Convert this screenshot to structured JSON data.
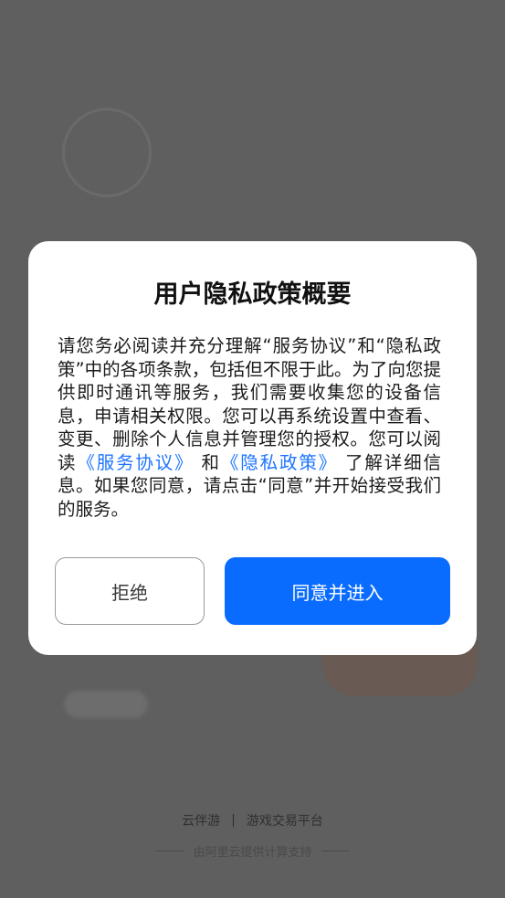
{
  "dialog": {
    "title": "用户隐私政策概要",
    "body_part1": "请您务必阅读并充分理解“服务协议”和“隐私政策”中的各项条款，包括但不限于此。为了向您提供即时通讯等服务，我们需要收集您的设备信息，申请相关权限。您可以再系统设置中查看、变更、删除个人信息并管理您的授权。您可以阅读",
    "link_service": "《服务协议》",
    "body_and": "和",
    "link_privacy": "《隐私政策》",
    "body_part2": " 了解详细信息。如果您同意，请点击“同意”并开始接受我们的服务。",
    "reject_label": "拒绝",
    "agree_label": "同意并进入"
  },
  "footer": {
    "brand": "云伴游",
    "separator": "|",
    "slogan": "游戏交易平台",
    "powered_by": "由阿里云提供计算支持"
  },
  "colors": {
    "overlay": "#5f5f5f",
    "link": "#1d74ff",
    "primary_button": "#0a6cff"
  }
}
